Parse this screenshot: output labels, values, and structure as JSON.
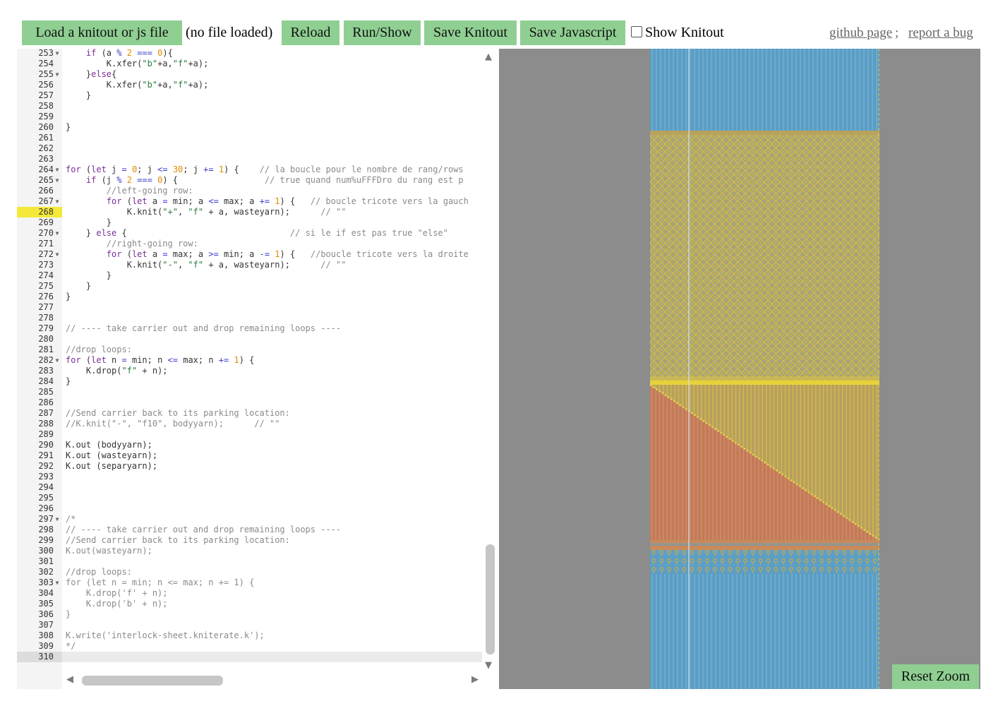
{
  "toolbar": {
    "load_label": "Load a knitout or js file",
    "file_status": "(no file loaded)",
    "reload_label": "Reload",
    "run_label": "Run/Show",
    "save_knitout_label": "Save Knitout",
    "save_js_label": "Save Javascript",
    "show_knitout_label": "Show Knitout",
    "show_knitout_checked": false,
    "github_label": "github page",
    "bug_label": "report a bug"
  },
  "editor": {
    "highlighted_line": 268,
    "cursor_line": 310,
    "lines": [
      {
        "n": 253,
        "fold": true,
        "code": "    if (a % 2 === 0){"
      },
      {
        "n": 254,
        "fold": false,
        "code": "        K.xfer(\"b\"+a,\"f\"+a);"
      },
      {
        "n": 255,
        "fold": true,
        "code": "    }else{"
      },
      {
        "n": 256,
        "fold": false,
        "code": "        K.xfer(\"b\"+a,\"f\"+a);"
      },
      {
        "n": 257,
        "fold": false,
        "code": "    }"
      },
      {
        "n": 258,
        "fold": false,
        "code": ""
      },
      {
        "n": 259,
        "fold": false,
        "code": ""
      },
      {
        "n": 260,
        "fold": false,
        "code": "}"
      },
      {
        "n": 261,
        "fold": false,
        "code": ""
      },
      {
        "n": 262,
        "fold": false,
        "code": ""
      },
      {
        "n": 263,
        "fold": false,
        "code": ""
      },
      {
        "n": 264,
        "fold": true,
        "code": "for (let j = 0; j <= 30; j += 1) {    // la boucle pour le nombre de rang/rows"
      },
      {
        "n": 265,
        "fold": true,
        "code": "    if (j % 2 === 0) {                 // true quand num%uFFFDro du rang est p"
      },
      {
        "n": 266,
        "fold": false,
        "code": "        //left-going row:"
      },
      {
        "n": 267,
        "fold": true,
        "code": "        for (let a = min; a <= max; a += 1) {   // boucle tricote vers la gauch"
      },
      {
        "n": 268,
        "fold": false,
        "code": "            K.knit(\"+\", \"f\" + a, wasteyarn);      // \"\""
      },
      {
        "n": 269,
        "fold": false,
        "code": "        }"
      },
      {
        "n": 270,
        "fold": true,
        "code": "    } else {                                // si le if est pas true \"else\""
      },
      {
        "n": 271,
        "fold": false,
        "code": "        //right-going row:"
      },
      {
        "n": 272,
        "fold": true,
        "code": "        for (let a = max; a >= min; a -= 1) {   //boucle tricote vers la droite"
      },
      {
        "n": 273,
        "fold": false,
        "code": "            K.knit(\"-\", \"f\" + a, wasteyarn);      // \"\""
      },
      {
        "n": 274,
        "fold": false,
        "code": "        }"
      },
      {
        "n": 275,
        "fold": false,
        "code": "    }"
      },
      {
        "n": 276,
        "fold": false,
        "code": "}"
      },
      {
        "n": 277,
        "fold": false,
        "code": ""
      },
      {
        "n": 278,
        "fold": false,
        "code": ""
      },
      {
        "n": 279,
        "fold": false,
        "code": "// ---- take carrier out and drop remaining loops ----"
      },
      {
        "n": 280,
        "fold": false,
        "code": ""
      },
      {
        "n": 281,
        "fold": false,
        "code": "//drop loops:"
      },
      {
        "n": 282,
        "fold": true,
        "code": "for (let n = min; n <= max; n += 1) {"
      },
      {
        "n": 283,
        "fold": false,
        "code": "    K.drop(\"f\" + n);"
      },
      {
        "n": 284,
        "fold": false,
        "code": "}"
      },
      {
        "n": 285,
        "fold": false,
        "code": ""
      },
      {
        "n": 286,
        "fold": false,
        "code": ""
      },
      {
        "n": 287,
        "fold": false,
        "code": "//Send carrier back to its parking location:"
      },
      {
        "n": 288,
        "fold": false,
        "code": "//K.knit(\"-\", \"f10\", bodyyarn);      // \"\""
      },
      {
        "n": 289,
        "fold": false,
        "code": ""
      },
      {
        "n": 290,
        "fold": false,
        "code": "K.out (bodyyarn);"
      },
      {
        "n": 291,
        "fold": false,
        "code": "K.out (wasteyarn);"
      },
      {
        "n": 292,
        "fold": false,
        "code": "K.out (separyarn);"
      },
      {
        "n": 293,
        "fold": false,
        "code": ""
      },
      {
        "n": 294,
        "fold": false,
        "code": ""
      },
      {
        "n": 295,
        "fold": false,
        "code": ""
      },
      {
        "n": 296,
        "fold": false,
        "code": ""
      },
      {
        "n": 297,
        "fold": true,
        "code": "/*"
      },
      {
        "n": 298,
        "fold": false,
        "code": "// ---- take carrier out and drop remaining loops ----"
      },
      {
        "n": 299,
        "fold": false,
        "code": "//Send carrier back to its parking location:"
      },
      {
        "n": 300,
        "fold": false,
        "code": "K.out(wasteyarn);"
      },
      {
        "n": 301,
        "fold": false,
        "code": ""
      },
      {
        "n": 302,
        "fold": false,
        "code": "//drop loops:"
      },
      {
        "n": 303,
        "fold": true,
        "code": "for (let n = min; n <= max; n += 1) {"
      },
      {
        "n": 304,
        "fold": false,
        "code": "    K.drop('f' + n);"
      },
      {
        "n": 305,
        "fold": false,
        "code": "    K.drop('b' + n);"
      },
      {
        "n": 306,
        "fold": false,
        "code": "}"
      },
      {
        "n": 307,
        "fold": false,
        "code": ""
      },
      {
        "n": 308,
        "fold": false,
        "code": "K.write('interlock-sheet.kniterate.k');"
      },
      {
        "n": 309,
        "fold": false,
        "code": "*/"
      },
      {
        "n": 310,
        "fold": false,
        "code": ""
      }
    ]
  },
  "viewer": {
    "reset_label": "Reset Zoom",
    "colors": {
      "background": "#8c8c8c",
      "blue_yarn": "#5b9fc6",
      "yellow_yarn": "#c9b84a",
      "orange_yarn": "#c27a5a",
      "separator": "#e8d23a"
    }
  },
  "icons": [
    "scroll-up-arrow-icon",
    "scroll-down-arrow-icon",
    "scroll-left-arrow-icon",
    "scroll-right-arrow-icon",
    "fold-arrow-icon"
  ]
}
